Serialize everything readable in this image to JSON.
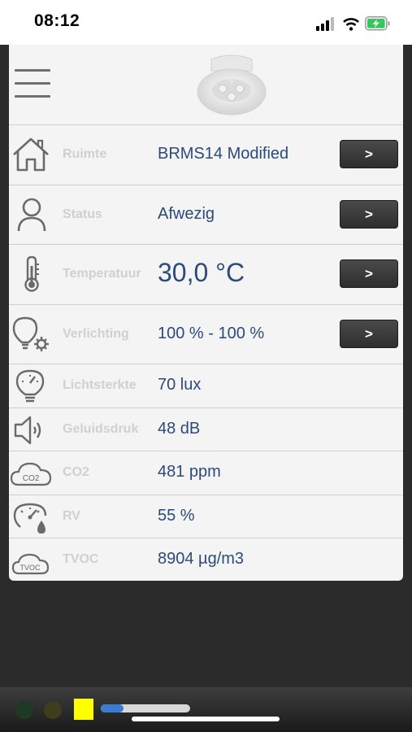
{
  "status_bar": {
    "time": "08:12",
    "icons": [
      "signal-bars-icon",
      "wifi-icon",
      "battery-charging-icon"
    ],
    "battery_color": "#34c759"
  },
  "header": {
    "menu_icon": "hamburger-menu-icon",
    "device_image": "ceiling-sensor-image"
  },
  "rows": [
    {
      "icon": "house-icon",
      "label": "Ruimte",
      "value": "BRMS14 Modified",
      "button": ">"
    },
    {
      "icon": "person-icon",
      "label": "Status",
      "value": "Afwezig",
      "button": ">"
    },
    {
      "icon": "thermometer-icon",
      "label": "Temperatuur",
      "value": "30,0 °C",
      "button": ">"
    },
    {
      "icon": "bulb-gear-icon",
      "label": "Verlichting",
      "value": "100 %  - 100 %",
      "button": ">"
    },
    {
      "icon": "bulb-gauge-icon",
      "label": "Lichtsterkte",
      "value": "70 lux"
    },
    {
      "icon": "speaker-icon",
      "label": "Geluidsdruk",
      "value": "48 dB"
    },
    {
      "icon": "cloud-co2-icon",
      "label": "CO2",
      "value": "481 ppm",
      "icon_text": "CO2"
    },
    {
      "icon": "gauge-drop-icon",
      "label": "RV",
      "value": "55 %"
    },
    {
      "icon": "cloud-tvoc-icon",
      "label": "TVOC",
      "value": "8904 µg/m3",
      "icon_text": "TVOC"
    }
  ],
  "bottom_bar": {
    "progress": 0.25,
    "colors": {
      "dot1": "#1f3a24",
      "dot2": "#3e3d1c",
      "square": "#ffff00",
      "progress_fill": "#3d7bd3"
    }
  }
}
